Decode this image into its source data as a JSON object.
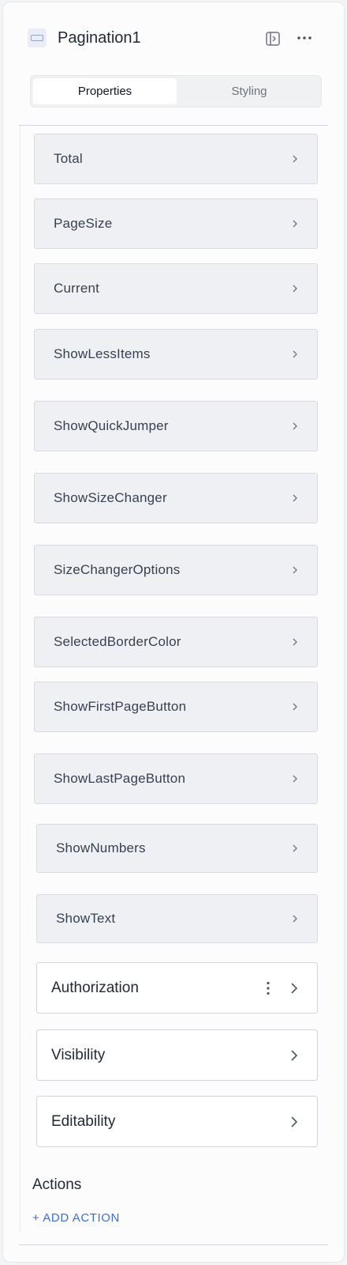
{
  "header": {
    "title": "Pagination1",
    "icon": "pagination-component-icon",
    "actions": [
      "dock-panel-icon",
      "more-options-icon"
    ]
  },
  "tabs": [
    {
      "label": "Properties",
      "active": true
    },
    {
      "label": "Styling",
      "active": false
    }
  ],
  "properties": [
    {
      "label": "Total"
    },
    {
      "label": "PageSize"
    },
    {
      "label": "Current"
    },
    {
      "label": "ShowLessItems"
    },
    {
      "label": "ShowQuickJumper"
    },
    {
      "label": "ShowSizeChanger"
    },
    {
      "label": "SizeChangerOptions"
    },
    {
      "label": "SelectedBorderColor"
    },
    {
      "label": "ShowFirstPageButton"
    },
    {
      "label": "ShowLastPageButton"
    },
    {
      "label": "ShowNumbers"
    },
    {
      "label": "ShowText"
    }
  ],
  "permissions": [
    {
      "label": "Authorization"
    },
    {
      "label": "Visibility"
    },
    {
      "label": "Editability"
    }
  ],
  "actions": {
    "title": "Actions",
    "add_label": "+ ADD ACTION"
  }
}
